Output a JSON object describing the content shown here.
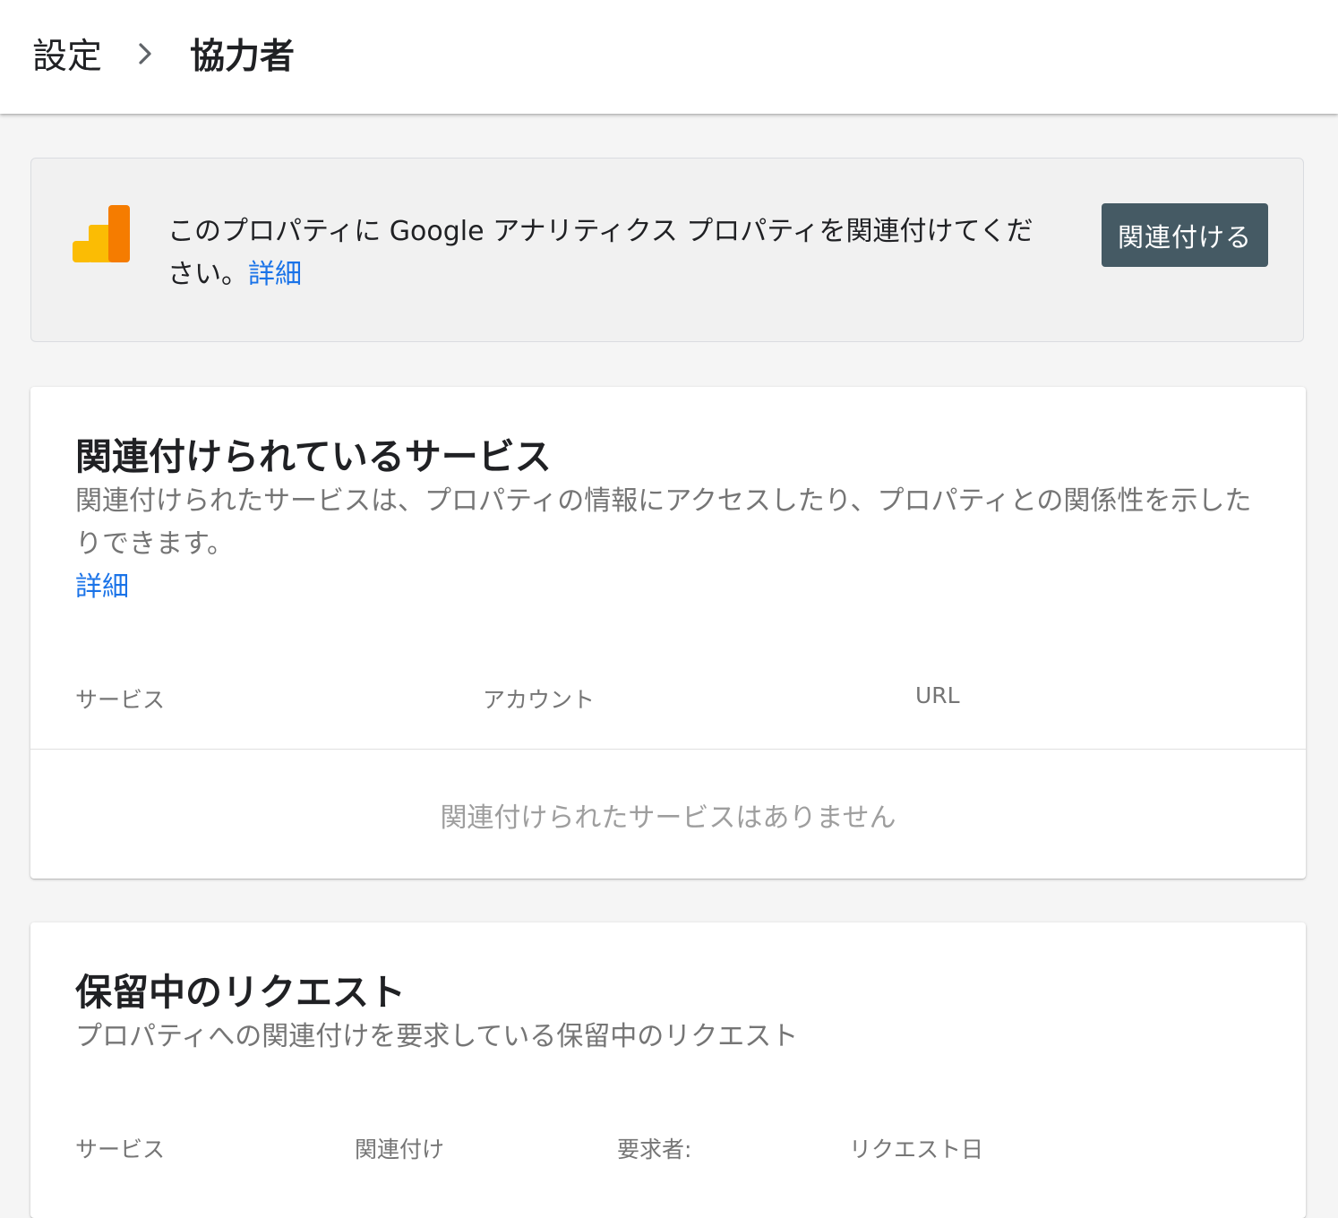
{
  "header": {
    "breadcrumb": [
      "設定",
      "協力者"
    ]
  },
  "banner": {
    "icon": "google-analytics-icon",
    "message": "このプロパティに Google アナリティクス プロパティを関連付けてください。",
    "learn_more": "詳細",
    "button_label": "関連付ける"
  },
  "linked_services": {
    "title": "関連付けられているサービス",
    "description": "関連付けられたサービスは、プロパティの情報にアクセスしたり、プロパティとの関係性を示したりできます。",
    "learn_more": "詳細",
    "columns": [
      "サービス",
      "アカウント",
      "URL"
    ],
    "empty_message": "関連付けられたサービスはありません"
  },
  "pending_requests": {
    "title": "保留中のリクエスト",
    "description": "プロパティへの関連付けを要求している保留中のリクエスト",
    "columns": [
      "サービス",
      "関連付け",
      "要求者:",
      "リクエスト日"
    ]
  },
  "colors": {
    "link": "#1a73e8",
    "button_bg": "#455a64",
    "ga_yellow": "#fbbc04",
    "ga_orange": "#f57c00"
  }
}
